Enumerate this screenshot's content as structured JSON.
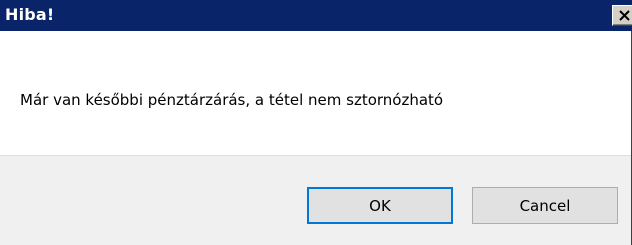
{
  "window": {
    "title": "Hiba!",
    "close_icon": "close-icon"
  },
  "message": {
    "text": "Már van későbbi pénztárzárás, a tétel nem sztornózható"
  },
  "buttons": {
    "ok_label": "OK",
    "cancel_label": "Cancel"
  },
  "colors": {
    "title_bar": "#0a246a",
    "title_text": "#ffffff",
    "button_bar": "#f0f0f0",
    "default_button_border": "#0078d7"
  }
}
